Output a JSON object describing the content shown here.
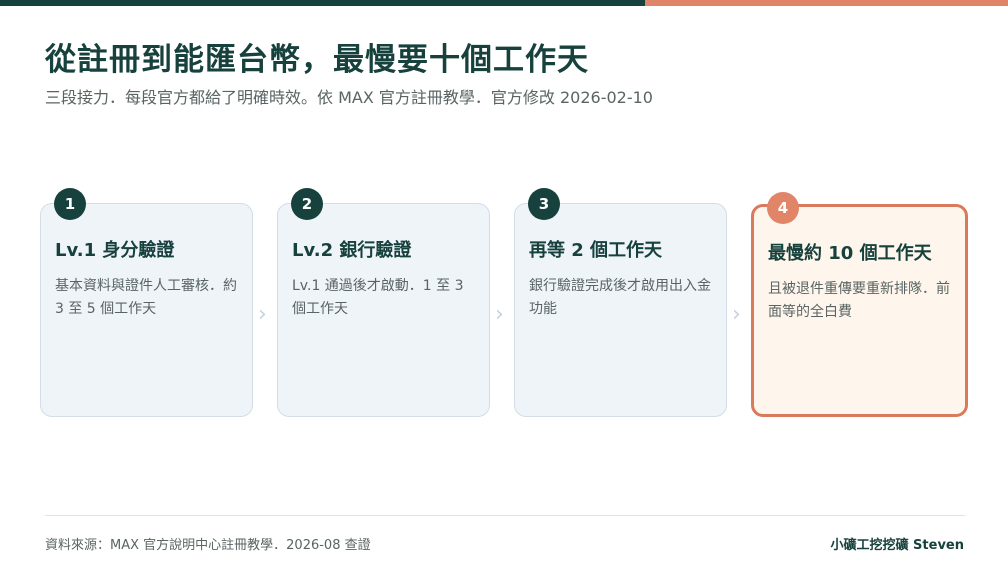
{
  "header": {
    "title": "從註冊到能匯台幣，最慢要十個工作天",
    "subtitle": "三段接力．每段官方都給了明確時效。依 MAX 官方註冊教學．官方修改 2026-02-10"
  },
  "steps": [
    {
      "number": "1",
      "title": "Lv.1 身分驗證",
      "desc": "基本資料與證件人工審核．約 3 至 5 個工作天"
    },
    {
      "number": "2",
      "title": "Lv.2 銀行驗證",
      "desc": "Lv.1 通過後才啟動．1 至 3 個工作天"
    },
    {
      "number": "3",
      "title": "再等 2 個工作天",
      "desc": "銀行驗證完成後才啟用出入金功能"
    },
    {
      "number": "4",
      "title": "最慢約 10 個工作天",
      "desc": "且被退件重傳要重新排隊．前面等的全白費"
    }
  ],
  "footer": {
    "source": "資料來源：MAX 官方說明中心註冊教學．2026-08 查證",
    "brand": "小礦工挖挖礦 Steven"
  },
  "colors": {
    "primary": "#17413d",
    "accent": "#e08567",
    "card_bg": "#eff4f9",
    "highlight_bg": "#fef6ec"
  },
  "icons": {
    "separator": "chevron-right-icon"
  }
}
